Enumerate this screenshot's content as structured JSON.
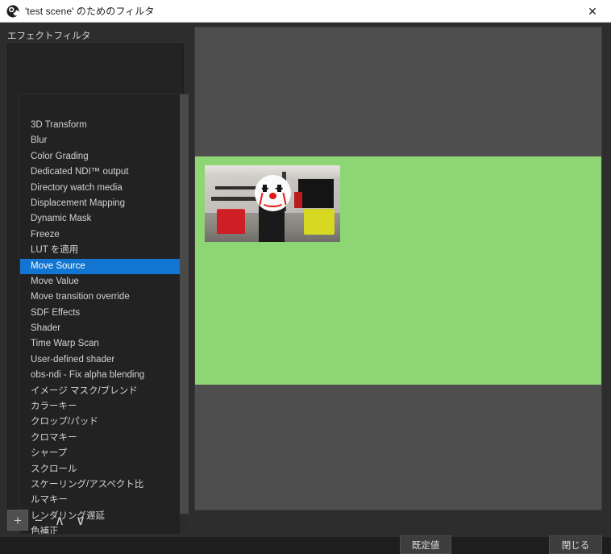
{
  "window": {
    "title": "'test scene' のためのフィルタ",
    "app_icon": "obs-logo-icon",
    "close_label": "✕"
  },
  "left_panel": {
    "section_label": "エフェクトフィルタ",
    "toolbar": {
      "add_label": "+",
      "remove_label": "−",
      "move_up_label": "∧",
      "move_down_label": "∨"
    }
  },
  "popup_menu": {
    "selected": "Move Source",
    "highlight_color": "#1175d1",
    "items": [
      {
        "label": "3D Transform"
      },
      {
        "label": "Blur"
      },
      {
        "label": "Color Grading"
      },
      {
        "label": "Dedicated NDI™ output"
      },
      {
        "label": "Directory watch media"
      },
      {
        "label": "Displacement Mapping"
      },
      {
        "label": "Dynamic Mask"
      },
      {
        "label": "Freeze"
      },
      {
        "label": "LUT を適用"
      },
      {
        "label": "Move Source"
      },
      {
        "label": "Move Value"
      },
      {
        "label": "Move transition override"
      },
      {
        "label": "SDF Effects"
      },
      {
        "label": "Shader"
      },
      {
        "label": "Time Warp Scan"
      },
      {
        "label": "User-defined shader"
      },
      {
        "label": "obs-ndi - Fix alpha blending"
      },
      {
        "label": "イメージ マスク/ブレンド"
      },
      {
        "label": "カラーキー"
      },
      {
        "label": "クロップ/パッド"
      },
      {
        "label": "クロマキー"
      },
      {
        "label": "シャープ"
      },
      {
        "label": "スクロール"
      },
      {
        "label": "スケーリング/アスペクト比"
      },
      {
        "label": "ルマキー"
      },
      {
        "label": "レンダリング遅延"
      },
      {
        "label": "色補正"
      }
    ]
  },
  "preview": {
    "background_color": "#4e4e4e",
    "canvas_color": "#8ed573",
    "source_name": "room photo with clown face overlay"
  },
  "footer": {
    "defaults_label": "既定値",
    "close_label": "閉じる"
  }
}
